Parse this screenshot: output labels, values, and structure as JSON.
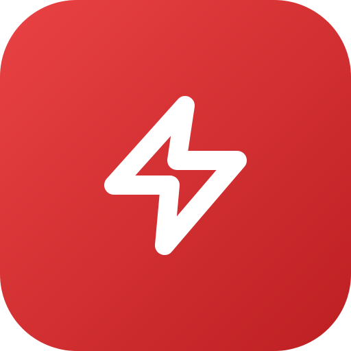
{
  "app_icon": {
    "icon_name": "lightning-bolt-icon",
    "colors": {
      "gradient_start": "#E94244",
      "gradient_end": "#BD1F22",
      "glyph": "#FFFFFF"
    }
  }
}
